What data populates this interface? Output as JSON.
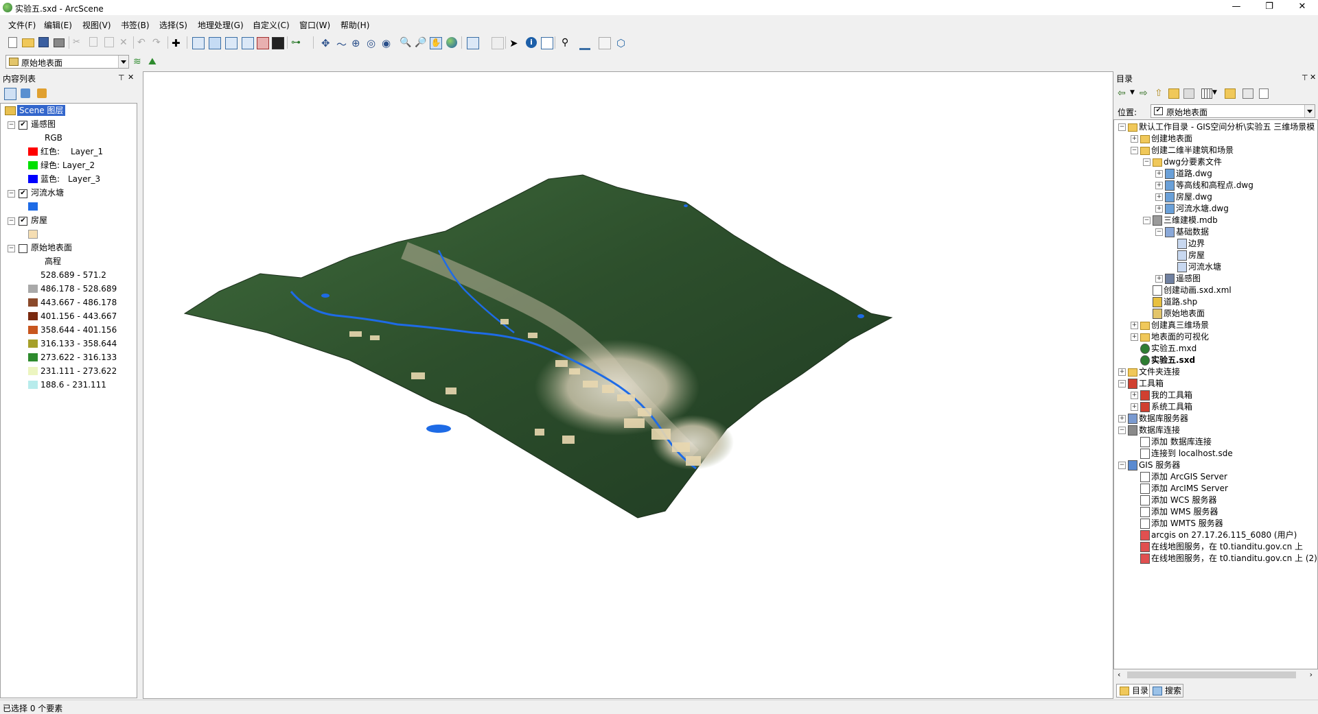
{
  "window": {
    "title": "实验五.sxd - ArcScene",
    "min": "—",
    "max": "❐",
    "close": "✕"
  },
  "menu": [
    "文件(F)",
    "编辑(E)",
    "视图(V)",
    "书签(B)",
    "选择(S)",
    "地理处理(G)",
    "自定义(C)",
    "窗口(W)",
    "帮助(H)"
  ],
  "layer_combo": {
    "value": "原始地表面"
  },
  "toc": {
    "title": "内容列表",
    "pin": "⊤",
    "close": "✕",
    "root": "Scene 图层",
    "layers": [
      {
        "name": "遥感图",
        "checked": true,
        "sub": "RGB",
        "items": [
          {
            "label": "红色:",
            "value": "Layer_1",
            "color": "#ff0000"
          },
          {
            "label": "绿色:",
            "value": "Layer_2",
            "color": "#00e000"
          },
          {
            "label": "蓝色:",
            "value": "Layer_3",
            "color": "#0000ff"
          }
        ]
      },
      {
        "name": "河流水塘",
        "checked": true,
        "color": "#1e6be6"
      },
      {
        "name": "房屋",
        "checked": true,
        "color": "#f5deb3"
      },
      {
        "name": "原始地表面",
        "checked": false,
        "sub": "高程",
        "classes": [
          {
            "range": "528.689 - 571.2",
            "color": "#ffffff"
          },
          {
            "range": "486.178 - 528.689",
            "color": "#a9a9a9"
          },
          {
            "range": "443.667 - 486.178",
            "color": "#8b4a2b"
          },
          {
            "range": "401.156 - 443.667",
            "color": "#7a2a10"
          },
          {
            "range": "358.644 - 401.156",
            "color": "#c8561e"
          },
          {
            "range": "316.133 - 358.644",
            "color": "#a6a02a"
          },
          {
            "range": "273.622 - 316.133",
            "color": "#2e8b2e"
          },
          {
            "range": "231.111 - 273.622",
            "color": "#ecf5c0"
          },
          {
            "range": "188.6 - 231.111",
            "color": "#b8ecec"
          }
        ]
      }
    ]
  },
  "catalog": {
    "title": "目录",
    "pin": "⊤",
    "close": "✕",
    "location_label": "位置:",
    "location_value": "原始地表面",
    "tree": [
      {
        "level": 0,
        "exp": "⊟",
        "icon": "folder",
        "text": "默认工作目录 - GIS空间分析\\实验五 三维场景模"
      },
      {
        "level": 1,
        "exp": "⊞",
        "icon": "folder",
        "text": "创建地表面"
      },
      {
        "level": 1,
        "exp": "⊟",
        "icon": "folder",
        "text": "创建二维半建筑和场景"
      },
      {
        "level": 2,
        "exp": "⊟",
        "icon": "folder",
        "text": "dwg分要素文件"
      },
      {
        "level": 3,
        "exp": "⊞",
        "icon": "dwg",
        "text": "道路.dwg"
      },
      {
        "level": 3,
        "exp": "⊞",
        "icon": "dwg",
        "text": "等高线和高程点.dwg"
      },
      {
        "level": 3,
        "exp": "⊞",
        "icon": "dwg",
        "text": "房屋.dwg"
      },
      {
        "level": 3,
        "exp": "⊞",
        "icon": "dwg",
        "text": "河流水塘.dwg"
      },
      {
        "level": 2,
        "exp": "⊟",
        "icon": "mdb",
        "text": "三维建模.mdb"
      },
      {
        "level": 3,
        "exp": "⊟",
        "icon": "dataset",
        "text": "基础数据"
      },
      {
        "level": 4,
        "exp": "",
        "icon": "fc",
        "text": "边界"
      },
      {
        "level": 4,
        "exp": "",
        "icon": "fc",
        "text": "房屋"
      },
      {
        "level": 4,
        "exp": "",
        "icon": "fc",
        "text": "河流水塘"
      },
      {
        "level": 3,
        "exp": "⊞",
        "icon": "raster",
        "text": "遥感图"
      },
      {
        "level": 2,
        "exp": "",
        "icon": "xml",
        "text": "创建动画.sxd.xml"
      },
      {
        "level": 2,
        "exp": "",
        "icon": "shp",
        "text": "道路.shp"
      },
      {
        "level": 2,
        "exp": "",
        "icon": "tin",
        "text": "原始地表面"
      },
      {
        "level": 1,
        "exp": "⊞",
        "icon": "folder",
        "text": "创建真三维场景"
      },
      {
        "level": 1,
        "exp": "⊞",
        "icon": "folder",
        "text": "地表面的可视化"
      },
      {
        "level": 1,
        "exp": "",
        "icon": "mxd",
        "text": "实验五.mxd"
      },
      {
        "level": 1,
        "exp": "",
        "icon": "sxd",
        "text": "实验五.sxd",
        "bold": true
      },
      {
        "level": 0,
        "exp": "⊞",
        "icon": "folderconn",
        "text": "文件夹连接"
      },
      {
        "level": 0,
        "exp": "⊟",
        "icon": "toolbox",
        "text": "工具箱"
      },
      {
        "level": 1,
        "exp": "⊞",
        "icon": "toolbox",
        "text": "我的工具箱"
      },
      {
        "level": 1,
        "exp": "⊞",
        "icon": "toolbox",
        "text": "系统工具箱"
      },
      {
        "level": 0,
        "exp": "⊞",
        "icon": "dbserver",
        "text": "数据库服务器"
      },
      {
        "level": 0,
        "exp": "⊟",
        "icon": "dbconn",
        "text": "数据库连接"
      },
      {
        "level": 1,
        "exp": "",
        "icon": "add",
        "text": "添加 数据库连接"
      },
      {
        "level": 1,
        "exp": "",
        "icon": "sde",
        "text": "连接到 localhost.sde"
      },
      {
        "level": 0,
        "exp": "⊟",
        "icon": "gis",
        "text": "GIS 服务器"
      },
      {
        "level": 1,
        "exp": "",
        "icon": "add",
        "text": "添加 ArcGIS Server"
      },
      {
        "level": 1,
        "exp": "",
        "icon": "add",
        "text": "添加 ArcIMS Server"
      },
      {
        "level": 1,
        "exp": "",
        "icon": "add",
        "text": "添加 WCS 服务器"
      },
      {
        "level": 1,
        "exp": "",
        "icon": "add",
        "text": "添加 WMS 服务器"
      },
      {
        "level": 1,
        "exp": "",
        "icon": "add",
        "text": "添加 WMTS 服务器"
      },
      {
        "level": 1,
        "exp": "",
        "icon": "server",
        "text": "arcgis on 27.17.26.115_6080 (用户)"
      },
      {
        "level": 1,
        "exp": "",
        "icon": "server",
        "text": "在线地图服务，在 t0.tianditu.gov.cn 上"
      },
      {
        "level": 1,
        "exp": "",
        "icon": "server",
        "text": "在线地图服务，在 t0.tianditu.gov.cn 上 (2)"
      }
    ],
    "tabs": [
      "目录",
      "搜索"
    ]
  },
  "status": {
    "text": "已选择 0 个要素"
  }
}
